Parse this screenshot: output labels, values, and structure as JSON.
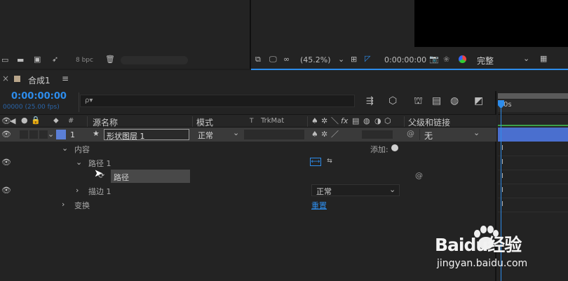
{
  "top_left": {
    "bpc": "8 bpc"
  },
  "viewer": {
    "zoom": "(45.2%)",
    "timecode": "0:00:00:00",
    "resolution": "完整",
    "resolution_icon": "chevron-down-icon"
  },
  "timeline_tab": {
    "comp_name": "合成1",
    "menu_glyph": "≡",
    "close_glyph": "×"
  },
  "time": {
    "current": "0:00:00:00",
    "fps": "00000 (25.00 fps)",
    "search_placeholder": "ρ▾"
  },
  "ruler": {
    "start": "0s"
  },
  "columns": {
    "hash": "#",
    "source_name": "源名称",
    "mode": "模式",
    "t": "T",
    "trkmat": "TrkMat",
    "parent": "父级和链接",
    "switch_fx": "fx"
  },
  "layer": {
    "number": "1",
    "name": "形状图层 1",
    "mode": "正常",
    "parent": "无"
  },
  "contents": {
    "label": "内容",
    "add_label": "添加:",
    "path_group": "路径 1",
    "path_prop": "路径",
    "stroke": "描边 1",
    "stroke_mode": "正常",
    "transform": "变换",
    "reset": "重置"
  },
  "watermark": {
    "brand": "Baidu经验",
    "url": "jingyan.baidu.com"
  },
  "colors": {
    "accent_blue": "#2d8ceb",
    "layer_label": "#5b7fd6",
    "layer_bar": "#4a6fcf"
  }
}
